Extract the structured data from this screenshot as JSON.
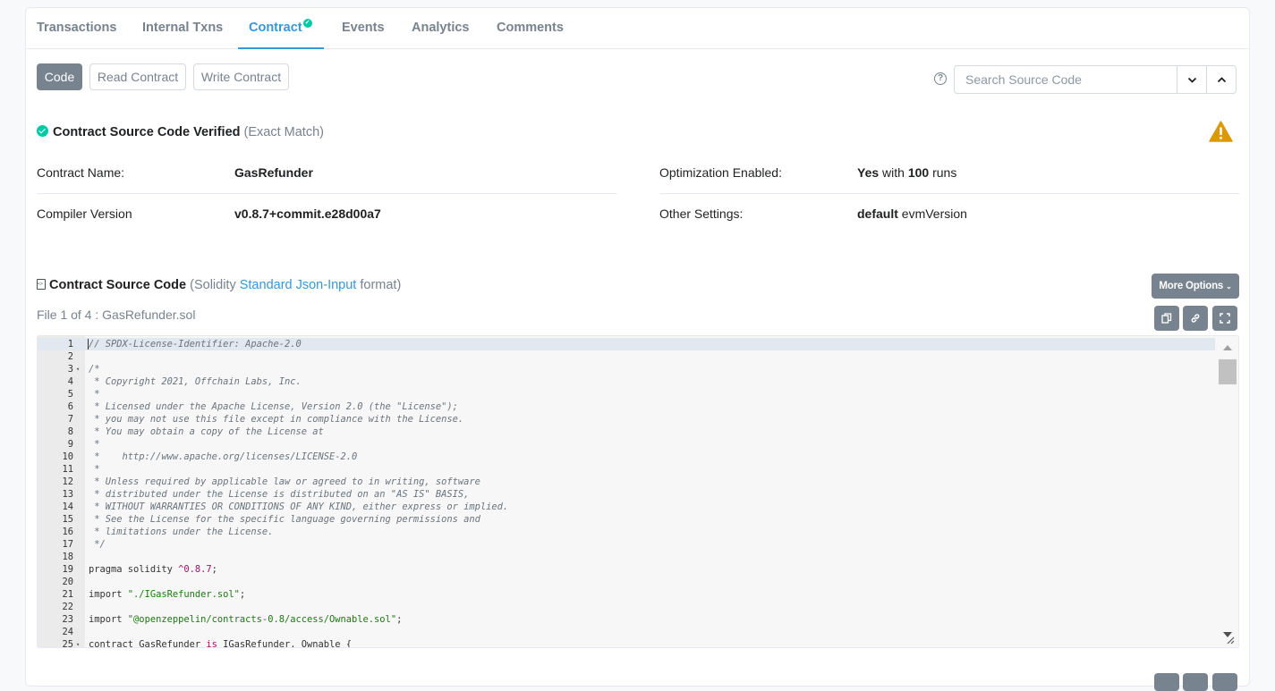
{
  "tabs": [
    {
      "label": "Transactions"
    },
    {
      "label": "Internal Txns"
    },
    {
      "label": "Contract"
    },
    {
      "label": "Events"
    },
    {
      "label": "Analytics"
    },
    {
      "label": "Comments"
    }
  ],
  "active_tab": "Contract",
  "subtabs": {
    "code": "Code",
    "read": "Read Contract",
    "write": "Write Contract"
  },
  "search": {
    "placeholder": "Search Source Code",
    "help": "?"
  },
  "verified": {
    "title": "Contract Source Code Verified",
    "note": "(Exact Match)"
  },
  "info": {
    "contract_name_label": "Contract Name:",
    "contract_name": "GasRefunder",
    "compiler_label": "Compiler Version",
    "compiler": "v0.8.7+commit.e28d00a7",
    "optimization_label": "Optimization Enabled:",
    "optimization_yes": "Yes",
    "optimization_with": "with",
    "optimization_runs": "100",
    "optimization_runs_word": "runs",
    "settings_label": "Other Settings:",
    "settings_default": "default",
    "settings_evm": "evmVersion"
  },
  "source": {
    "title": "Contract Source Code",
    "format_prefix": "(Solidity",
    "format_link": "Standard Json-Input",
    "format_suffix": "format)",
    "more_options": "More Options",
    "file_label": "File 1 of 4 : GasRefunder.sol"
  },
  "colors": {
    "accent": "#3498db",
    "success": "#00c9a7",
    "warning": "#db9a04",
    "button": "#77838f"
  },
  "code_lines": [
    {
      "n": "1",
      "fold": "",
      "text": "// SPDX-License-Identifier: Apache-2.0",
      "type": "comment"
    },
    {
      "n": "2",
      "fold": "",
      "text": "",
      "type": "plain"
    },
    {
      "n": "3",
      "fold": "▾",
      "text": "/*",
      "type": "comment"
    },
    {
      "n": "4",
      "fold": "",
      "text": " * Copyright 2021, Offchain Labs, Inc.",
      "type": "comment"
    },
    {
      "n": "5",
      "fold": "",
      "text": " *",
      "type": "comment"
    },
    {
      "n": "6",
      "fold": "",
      "text": " * Licensed under the Apache License, Version 2.0 (the \"License\");",
      "type": "comment"
    },
    {
      "n": "7",
      "fold": "",
      "text": " * you may not use this file except in compliance with the License.",
      "type": "comment"
    },
    {
      "n": "8",
      "fold": "",
      "text": " * You may obtain a copy of the License at",
      "type": "comment"
    },
    {
      "n": "9",
      "fold": "",
      "text": " *",
      "type": "comment"
    },
    {
      "n": "10",
      "fold": "",
      "text": " *    http://www.apache.org/licenses/LICENSE-2.0",
      "type": "comment"
    },
    {
      "n": "11",
      "fold": "",
      "text": " *",
      "type": "comment"
    },
    {
      "n": "12",
      "fold": "",
      "text": " * Unless required by applicable law or agreed to in writing, software",
      "type": "comment"
    },
    {
      "n": "13",
      "fold": "",
      "text": " * distributed under the License is distributed on an \"AS IS\" BASIS,",
      "type": "comment"
    },
    {
      "n": "14",
      "fold": "",
      "text": " * WITHOUT WARRANTIES OR CONDITIONS OF ANY KIND, either express or implied.",
      "type": "comment"
    },
    {
      "n": "15",
      "fold": "",
      "text": " * See the License for the specific language governing permissions and",
      "type": "comment"
    },
    {
      "n": "16",
      "fold": "",
      "text": " * limitations under the License.",
      "type": "comment"
    },
    {
      "n": "17",
      "fold": "",
      "text": " */",
      "type": "comment"
    },
    {
      "n": "18",
      "fold": "",
      "text": "",
      "type": "plain"
    },
    {
      "n": "19",
      "fold": "",
      "parts": [
        [
          "pragma solidity ",
          "plain"
        ],
        [
          "^0.8.7",
          "num"
        ],
        [
          ";",
          "plain"
        ]
      ]
    },
    {
      "n": "20",
      "fold": "",
      "text": "",
      "type": "plain"
    },
    {
      "n": "21",
      "fold": "",
      "parts": [
        [
          "import ",
          "plain"
        ],
        [
          "\"./IGasRefunder.sol\"",
          "str"
        ],
        [
          ";",
          "plain"
        ]
      ]
    },
    {
      "n": "22",
      "fold": "",
      "text": "",
      "type": "plain"
    },
    {
      "n": "23",
      "fold": "",
      "parts": [
        [
          "import ",
          "plain"
        ],
        [
          "\"@openzeppelin/contracts-0.8/access/Ownable.sol\"",
          "str"
        ],
        [
          ";",
          "plain"
        ]
      ]
    },
    {
      "n": "24",
      "fold": "",
      "text": "",
      "type": "plain"
    },
    {
      "n": "25",
      "fold": "▾",
      "parts": [
        [
          "contract GasRefunder ",
          "plain"
        ],
        [
          "is",
          "op"
        ],
        [
          " IGasRefunder, Ownable {",
          "plain"
        ]
      ]
    }
  ]
}
